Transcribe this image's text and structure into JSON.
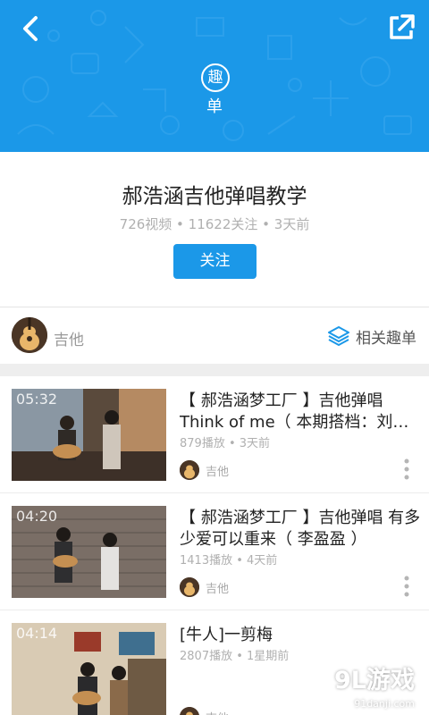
{
  "header": {
    "badge_char": "趣",
    "badge_sub": "单",
    "back_icon": "back-icon",
    "share_icon": "share-icon"
  },
  "playlist": {
    "title": "郝浩涵吉他弹唱教学",
    "meta": "726视频 • 11622关注 • 3天前",
    "follow_label": "关注"
  },
  "category": {
    "label": "吉他",
    "related_label": "相关趣单"
  },
  "videos": [
    {
      "duration": "05:32",
      "title": "【 郝浩涵梦工厂 】吉他弹唱 Think of me（ 本期搭档：刘…",
      "meta": "879播放 • 3天前",
      "uploader": "吉他"
    },
    {
      "duration": "04:20",
      "title": "【 郝浩涵梦工厂 】吉他弹唱 有多少爱可以重来（ 李盈盈 ）",
      "meta": "1413播放 • 4天前",
      "uploader": "吉他"
    },
    {
      "duration": "04:14",
      "title": "[牛人]一剪梅",
      "meta": "2807播放 • 1星期前",
      "uploader": "吉他"
    }
  ],
  "watermark": {
    "text": "9L游戏",
    "site": "91danji.com"
  },
  "colors": {
    "accent": "#1b98e8"
  }
}
